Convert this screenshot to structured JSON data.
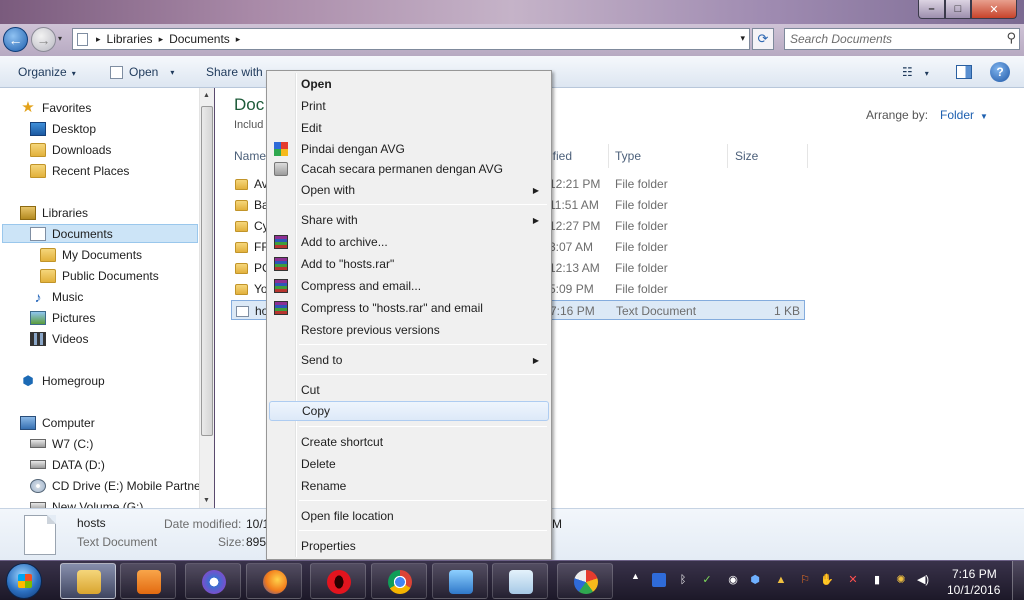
{
  "window": {
    "minimize_glyph": "–",
    "maximize_glyph": "□",
    "close_glyph": "✕"
  },
  "address": {
    "back_glyph": "←",
    "forward_glyph": "→",
    "crumbs": [
      "Libraries",
      "Documents"
    ],
    "separator": "▸",
    "dropdown_glyph": "▾",
    "refresh_glyph": "⟳",
    "search_placeholder": "Search Documents",
    "search_glyph": "⚲"
  },
  "commandbar": {
    "organize": "Organize",
    "open": "Open",
    "share_with": "Share with",
    "dropdown_glyph": "▾",
    "views_glyph": "☷",
    "help_glyph": "?"
  },
  "navigation": {
    "favorites": "Favorites",
    "desktop": "Desktop",
    "downloads": "Downloads",
    "recent_places": "Recent Places",
    "libraries": "Libraries",
    "documents": "Documents",
    "my_documents": "My Documents",
    "public_documents": "Public Documents",
    "music": "Music",
    "pictures": "Pictures",
    "videos": "Videos",
    "homegroup": "Homegroup",
    "computer": "Computer",
    "drive_c": "W7 (C:)",
    "drive_d": "DATA (D:)",
    "drive_e": "CD Drive (E:) Mobile Partner",
    "drive_g": "New Volume (G:)",
    "icons": {
      "star": "★",
      "music": "♪",
      "home": "⬢"
    }
  },
  "content": {
    "title": "Doc",
    "subtitle": "Includ",
    "arrange_label": "Arrange by:",
    "arrange_value": "Folder",
    "columns": {
      "name": "Name",
      "date": "ified",
      "type": "Type",
      "size": "Size"
    },
    "files": [
      {
        "name": "Av",
        "date": "12:21 PM",
        "type": "File folder",
        "size": ""
      },
      {
        "name": "Ba",
        "date": "11:51 AM",
        "type": "File folder",
        "size": ""
      },
      {
        "name": "Cy",
        "date": "12:27 PM",
        "type": "File folder",
        "size": ""
      },
      {
        "name": "FF",
        "date": "3:07 AM",
        "type": "File folder",
        "size": ""
      },
      {
        "name": "PC",
        "date": "12:13 AM",
        "type": "File folder",
        "size": ""
      },
      {
        "name": "Yo",
        "date": "5:09 PM",
        "type": "File folder",
        "size": ""
      },
      {
        "name": "ho",
        "date": "7:16 PM",
        "type": "Text Document",
        "size": "1 KB"
      }
    ]
  },
  "details": {
    "name": "hosts",
    "type": "Text Document",
    "modified_label": "Date modified:",
    "modified_value": "10/1",
    "size_label": "Size:",
    "size_value": "895",
    "menu_overlap_fragment": "M"
  },
  "context_menu": {
    "open": "Open",
    "print": "Print",
    "edit": "Edit",
    "avg_scan": "Pindai dengan AVG",
    "avg_shred": "Cacah secara permanen dengan AVG",
    "open_with": "Open with",
    "share_with": "Share with",
    "add_to_archive": "Add to archive...",
    "add_to_hosts_rar": "Add to \"hosts.rar\"",
    "compress_email": "Compress and email...",
    "compress_hosts_email": "Compress to \"hosts.rar\" and email",
    "restore_versions": "Restore previous versions",
    "send_to": "Send to",
    "cut": "Cut",
    "copy": "Copy",
    "create_shortcut": "Create shortcut",
    "delete": "Delete",
    "rename": "Rename",
    "open_file_location": "Open file location",
    "properties": "Properties",
    "submenu_glyph": "▶"
  },
  "taskbar": {
    "time": "7:16 PM",
    "date": "10/1/2016",
    "tray_arrow": "▲",
    "tray_glyphs": [
      "⚑",
      "✓",
      "⬢",
      "⚐",
      "✋",
      "✕",
      "▮",
      "✺",
      "◀)"
    ]
  },
  "colors": {
    "accent": "#1e60b0",
    "selection": "#cce4f7",
    "title_green": "#1e5b3a"
  }
}
